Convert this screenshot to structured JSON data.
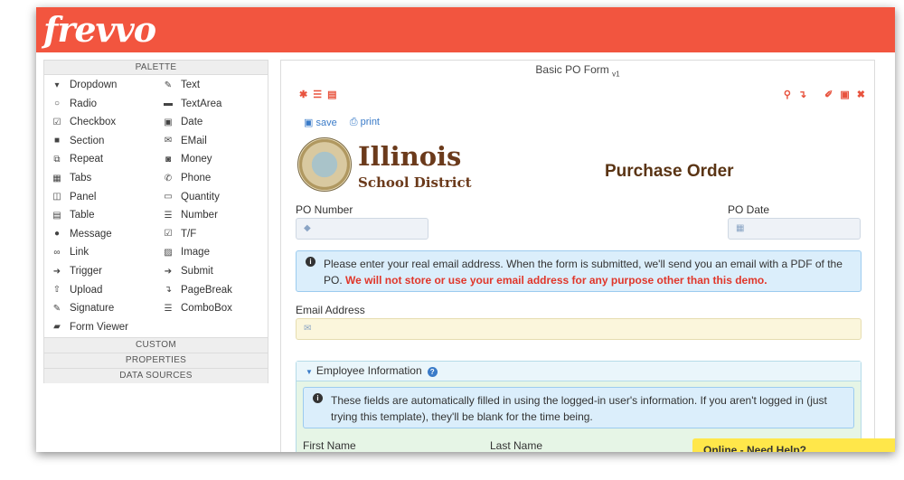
{
  "app": {
    "logo": "frevvo"
  },
  "palette": {
    "header": "PALETTE",
    "left": [
      {
        "label": "Dropdown",
        "icon": "dropdown-icon",
        "glyph": "▾"
      },
      {
        "label": "Radio",
        "icon": "radio-icon",
        "glyph": "○"
      },
      {
        "label": "Checkbox",
        "icon": "checkbox-icon",
        "glyph": "☑"
      },
      {
        "label": "Section",
        "icon": "folder-icon",
        "glyph": "■"
      },
      {
        "label": "Repeat",
        "icon": "repeat-icon",
        "glyph": "⧉"
      },
      {
        "label": "Tabs",
        "icon": "tabs-icon",
        "glyph": "▦"
      },
      {
        "label": "Panel",
        "icon": "panel-icon",
        "glyph": "◫"
      },
      {
        "label": "Table",
        "icon": "table-icon",
        "glyph": "▤"
      },
      {
        "label": "Message",
        "icon": "message-icon",
        "glyph": "●"
      },
      {
        "label": "Link",
        "icon": "link-icon",
        "glyph": "∞"
      },
      {
        "label": "Trigger",
        "icon": "trigger-icon",
        "glyph": "➜"
      },
      {
        "label": "Upload",
        "icon": "upload-icon",
        "glyph": "⇧"
      },
      {
        "label": "Signature",
        "icon": "pencil-icon",
        "glyph": "✎"
      },
      {
        "label": "Form Viewer",
        "icon": "book-icon",
        "glyph": "▰"
      }
    ],
    "right": [
      {
        "label": "Text",
        "icon": "edit-icon",
        "glyph": "✎"
      },
      {
        "label": "TextArea",
        "icon": "textarea-icon",
        "glyph": "▬"
      },
      {
        "label": "Date",
        "icon": "calendar-icon",
        "glyph": "▣"
      },
      {
        "label": "EMail",
        "icon": "envelope-icon",
        "glyph": "✉"
      },
      {
        "label": "Money",
        "icon": "money-icon",
        "glyph": "◙"
      },
      {
        "label": "Phone",
        "icon": "phone-icon",
        "glyph": "✆"
      },
      {
        "label": "Quantity",
        "icon": "keyboard-icon",
        "glyph": "▭"
      },
      {
        "label": "Number",
        "icon": "list-icon",
        "glyph": "☰"
      },
      {
        "label": "T/F",
        "icon": "checkbox-icon",
        "glyph": "☑"
      },
      {
        "label": "Image",
        "icon": "image-icon",
        "glyph": "▨"
      },
      {
        "label": "Submit",
        "icon": "submit-icon",
        "glyph": "➔"
      },
      {
        "label": "PageBreak",
        "icon": "pagebreak-icon",
        "glyph": "↴"
      },
      {
        "label": "ComboBox",
        "icon": "combobox-icon",
        "glyph": "☰"
      }
    ],
    "sections": [
      "CUSTOM",
      "PROPERTIES",
      "DATA SOURCES"
    ]
  },
  "form": {
    "title": "Basic PO Form",
    "version": "v1",
    "links": {
      "save": "save",
      "print": "print"
    },
    "heading": {
      "name": "Illinois",
      "subtitle": "School District",
      "title": "Purchase Order"
    },
    "po_number_label": "PO Number",
    "po_date_label": "PO Date",
    "info1_text": "Please enter your real email address. When the form is submitted, we'll send you an email with a PDF of the PO.",
    "info1_red": "We will not store or use your email address for any purpose other than this demo.",
    "email_label": "Email Address",
    "section_title": "Employee Information",
    "info2_text": "These fields are automatically filled in using the logged-in user's information. If you aren't logged in (just trying this template), they'll be blank for the time being.",
    "first_name_label": "First Name",
    "last_name_label": "Last Name"
  },
  "chat": {
    "label": "Online - Need Help?"
  },
  "colors": {
    "brand": "#f2553f",
    "link": "#3a7bc8",
    "warning_text": "#e0362a"
  }
}
